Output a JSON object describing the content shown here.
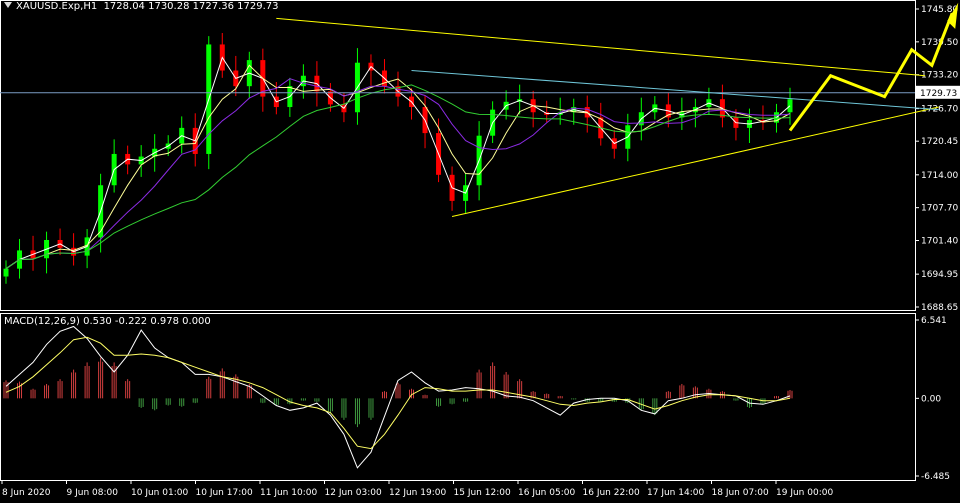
{
  "header": {
    "symbol": "XAUUSD.Exp,H1",
    "ohlc": "1728.04 1730.28 1727.36 1729.73"
  },
  "macd_header": {
    "label": "MACD(12,26,9) 0.530 -0.222 0.978 0.000"
  },
  "colors": {
    "background": "#000000",
    "grid_border": "#ffffff",
    "bull": "#00ff00",
    "bear": "#ff0000",
    "trend_yellow": "#ffff00",
    "trend_cyan": "#6fc6d8",
    "ma_white": "#ffffff",
    "ma_yellow": "#ffff99",
    "ma_purple": "#8a2be2",
    "ma_green": "#32cd32",
    "macd_pos": "#d43f3f",
    "macd_neg": "#3f9a3f",
    "macd_line": "#ffffff",
    "signal_line": "#ffff66"
  },
  "chart_data": [
    {
      "type": "line",
      "name": "price",
      "price_axis_ticks": [
        "1745.80",
        "1739.50",
        "1733.20",
        "1726.70",
        "1720.45",
        "1714.00",
        "1707.70",
        "1701.40",
        "1694.95",
        "1688.65"
      ],
      "current_price": "1729.73",
      "x_tick_labels": [
        "8 Jun 2020",
        "9 Jun 08:00",
        "10 Jun 01:00",
        "10 Jun 17:00",
        "11 Jun 10:00",
        "12 Jun 03:00",
        "12 Jun 19:00",
        "15 Jun 12:00",
        "16 Jun 05:00",
        "16 Jun 22:00",
        "17 Jun 14:00",
        "18 Jun 07:00",
        "19 Jun 00:00"
      ],
      "ylim": [
        1688.65,
        1745.8
      ],
      "series": [
        {
          "name": "close",
          "y": [
            1696.0,
            1699.5,
            1698.0,
            1701.5,
            1700.0,
            1698.5,
            1702.0,
            1712.0,
            1718.0,
            1716.0,
            1717.5,
            1719.0,
            1720.0,
            1723.0,
            1718.0,
            1739.0,
            1734.0,
            1731.0,
            1736.0,
            1729.0,
            1727.0,
            1731.0,
            1733.0,
            1730.0,
            1727.5,
            1726.0,
            1735.5,
            1734.0,
            1731.0,
            1729.0,
            1727.0,
            1722.0,
            1714.0,
            1709.0,
            1712.0,
            1721.5,
            1726.5,
            1728.0,
            1728.5,
            1726.0,
            1725.5,
            1726.0,
            1727.0,
            1725.0,
            1721.0,
            1719.0,
            1723.5,
            1726.0,
            1727.5,
            1725.0,
            1726.0,
            1727.0,
            1728.5,
            1725.0,
            1723.0,
            1724.5,
            1724.0,
            1726.0,
            1728.5
          ]
        }
      ],
      "annotations": [
        {
          "type": "trendline",
          "name": "upper resistance",
          "color": "yellow"
        },
        {
          "type": "trendline",
          "name": "lower support",
          "color": "yellow"
        },
        {
          "type": "trendline",
          "name": "inner resistance",
          "color": "cyan"
        },
        {
          "type": "arrow-path",
          "name": "forecast",
          "color": "yellow"
        }
      ]
    },
    {
      "type": "bar",
      "name": "macd",
      "axis_ticks": [
        "6.541",
        "0.00",
        "-6.485"
      ],
      "ylim": [
        -6.485,
        6.541
      ],
      "histogram": [
        1.5,
        1.4,
        0.8,
        1.2,
        1.6,
        2.4,
        3.0,
        3.4,
        3.0,
        1.6,
        -0.8,
        -1.0,
        -0.6,
        -0.7,
        -0.4,
        1.8,
        2.5,
        2.0,
        1.2,
        -0.4,
        -0.6,
        -0.5,
        -0.2,
        -0.3,
        -1.2,
        -1.8,
        -2.4,
        -1.8,
        0.6,
        1.3,
        0.8,
        0.3,
        -0.7,
        -0.5,
        -0.3,
        2.4,
        3.0,
        2.2,
        1.6,
        0.6,
        0.4,
        0.2,
        -0.1,
        -0.3,
        -0.3,
        -0.3,
        -0.4,
        -1.0,
        -1.4,
        0.6,
        1.2,
        1.0,
        0.8,
        0.6,
        -0.2,
        -0.8,
        -0.5,
        0.2,
        0.7
      ],
      "macd_line": [
        1.0,
        2.0,
        3.0,
        4.5,
        5.6,
        6.0,
        5.0,
        3.5,
        2.2,
        3.6,
        5.7,
        4.2,
        3.4,
        3.0,
        2.0,
        2.0,
        1.8,
        1.4,
        1.0,
        0.2,
        -0.6,
        -1.0,
        -0.8,
        -0.4,
        -1.4,
        -3.0,
        -5.8,
        -4.5,
        -1.5,
        1.5,
        2.2,
        1.3,
        0.6,
        0.7,
        0.9,
        0.8,
        0.6,
        0.2,
        0.1,
        -0.2,
        -0.8,
        -1.4,
        -0.4,
        -0.1,
        0.0,
        0.0,
        -0.2,
        -1.0,
        -1.3,
        -0.2,
        0.0,
        0.3,
        0.4,
        0.3,
        0.2,
        -0.4,
        -0.5,
        -0.2,
        0.2
      ],
      "signal_line": [
        0.5,
        1.0,
        1.8,
        2.8,
        3.8,
        4.9,
        5.1,
        4.6,
        3.6,
        3.6,
        3.7,
        3.6,
        3.4,
        3.0,
        2.6,
        2.2,
        1.8,
        1.6,
        1.3,
        0.9,
        0.3,
        -0.3,
        -0.6,
        -0.8,
        -1.2,
        -2.5,
        -4.0,
        -4.2,
        -3.0,
        -1.4,
        0.3,
        0.9,
        0.8,
        0.6,
        0.6,
        0.7,
        0.7,
        0.5,
        0.3,
        0.1,
        -0.2,
        -0.5,
        -0.6,
        -0.4,
        -0.3,
        -0.1,
        -0.1,
        -0.5,
        -0.9,
        -0.6,
        -0.2,
        0.1,
        0.3,
        0.3,
        0.2,
        0.0,
        -0.2,
        -0.2,
        0.0
      ]
    }
  ]
}
